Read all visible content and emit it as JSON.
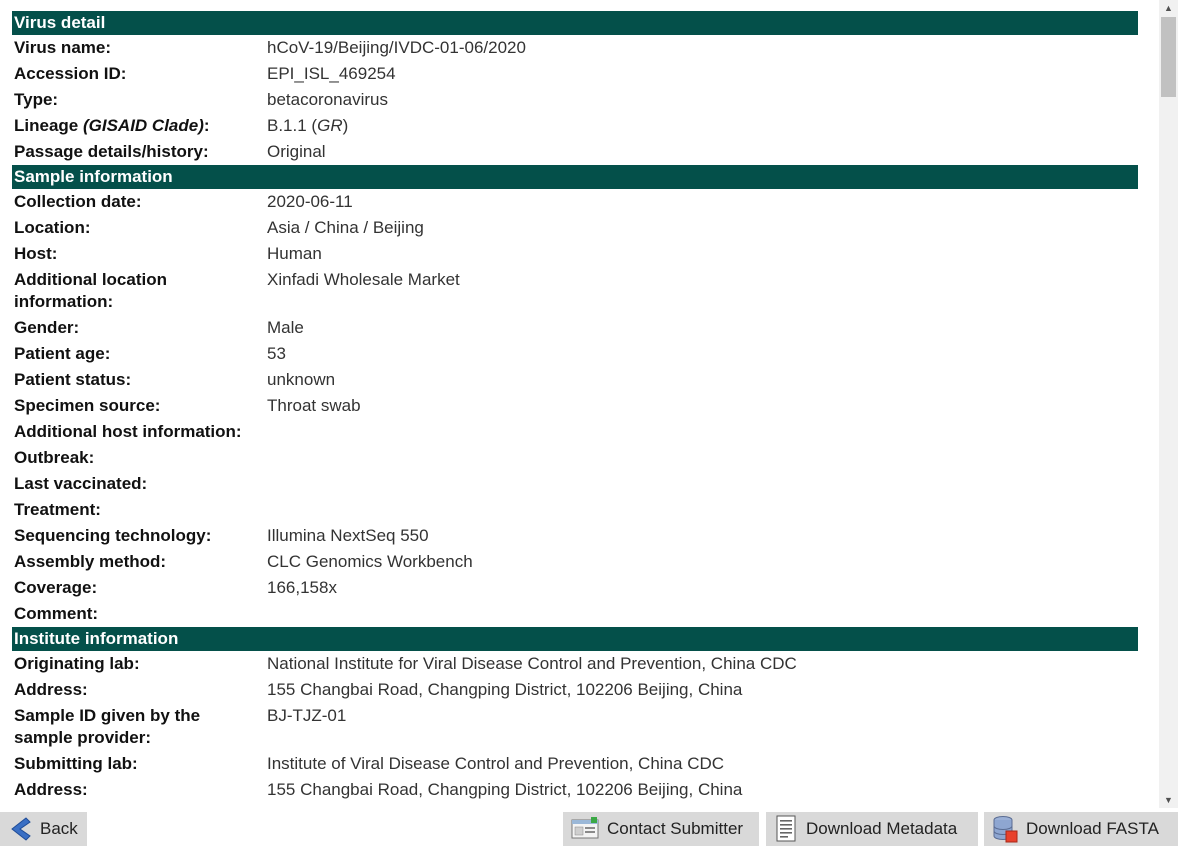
{
  "sections": {
    "virus_detail": {
      "title": "Virus detail",
      "rows": [
        {
          "label": "Virus name:",
          "value": "hCoV-19/Beijing/IVDC-01-06/2020"
        },
        {
          "label": "Accession ID:",
          "value": "EPI_ISL_469254"
        },
        {
          "label": "Type:",
          "value": "betacoronavirus"
        },
        {
          "label_main": "Lineage ",
          "label_italic": "(GISAID Clade)",
          "label_end": ":",
          "value_main": "B.1.1 (",
          "value_italic": "GR",
          "value_end": ")"
        },
        {
          "label": "Passage details/history:",
          "value": "Original"
        }
      ]
    },
    "sample_information": {
      "title": "Sample information",
      "rows": [
        {
          "label": "Collection date:",
          "value": "2020-06-11"
        },
        {
          "label": "Location:",
          "value": "Asia / China / Beijing"
        },
        {
          "label": "Host:",
          "value": "Human"
        },
        {
          "label": "Additional location information:",
          "value": "Xinfadi Wholesale Market"
        },
        {
          "label": "Gender:",
          "value": "Male"
        },
        {
          "label": "Patient age:",
          "value": "53"
        },
        {
          "label": "Patient status:",
          "value": "unknown"
        },
        {
          "label": "Specimen source:",
          "value": "Throat swab"
        },
        {
          "label": "Additional host information:",
          "value": ""
        },
        {
          "label": "Outbreak:",
          "value": ""
        },
        {
          "label": "Last vaccinated:",
          "value": ""
        },
        {
          "label": "Treatment:",
          "value": ""
        },
        {
          "label": "Sequencing technology:",
          "value": "Illumina NextSeq 550"
        },
        {
          "label": "Assembly method:",
          "value": "CLC Genomics Workbench"
        },
        {
          "label": "Coverage:",
          "value": "166,158x"
        },
        {
          "label": "Comment:",
          "value": ""
        }
      ]
    },
    "institute_information": {
      "title": "Institute information",
      "rows": [
        {
          "label": "Originating lab:",
          "value": "National Institute for Viral Disease Control and Prevention, China CDC"
        },
        {
          "label": "Address:",
          "value": "155 Changbai Road, Changping District, 102206 Beijing, China"
        },
        {
          "label": "Sample ID given by the sample provider:",
          "value": "BJ-TJZ-01"
        },
        {
          "label": "Submitting lab:",
          "value": "Institute of Viral Disease Control and Prevention, China CDC"
        },
        {
          "label": "Address:",
          "value": "155 Changbai Road, Changping District, 102206 Beijing, China"
        }
      ]
    }
  },
  "toolbar": {
    "back_label": "Back",
    "contact_label": "Contact Submitter",
    "metadata_label": "Download Metadata",
    "fasta_label": "Download FASTA"
  },
  "icons": {
    "back": "back-arrow-icon",
    "contact": "contact-card-icon",
    "metadata": "document-icon",
    "fasta": "database-download-icon"
  },
  "colors": {
    "section_header_bg": "#04504a",
    "section_header_text": "#ffffff",
    "button_bg": "#d9d9d9"
  }
}
